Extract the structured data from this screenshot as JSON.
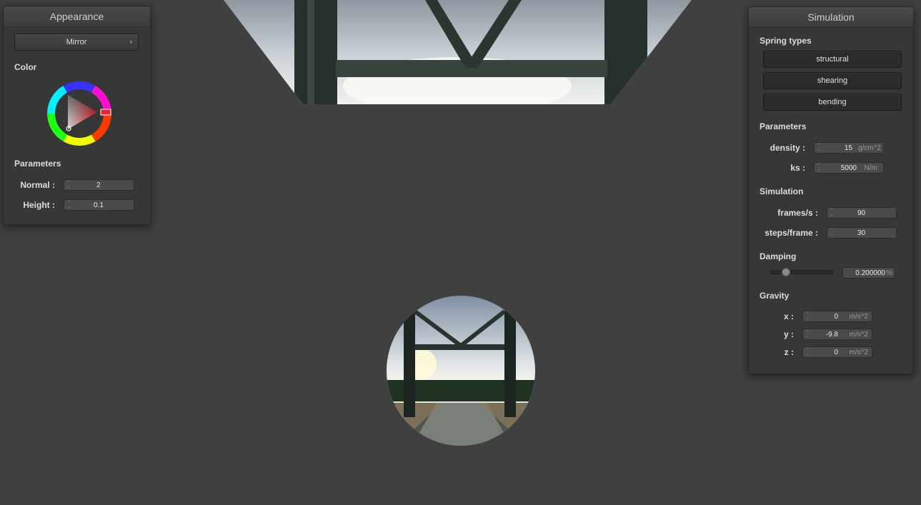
{
  "appearance": {
    "title": "Appearance",
    "material_dropdown": "Mirror",
    "color_label": "Color",
    "parameters_label": "Parameters",
    "normal": {
      "label": "Normal :",
      "value": "2"
    },
    "height": {
      "label": "Height :",
      "value": "0.1"
    }
  },
  "simulation": {
    "title": "Simulation",
    "spring_types_label": "Spring types",
    "spring_types": [
      "structural",
      "shearing",
      "bending"
    ],
    "parameters_label": "Parameters",
    "density": {
      "label": "density :",
      "value": "15",
      "unit": "g/cm^2"
    },
    "ks": {
      "label": "ks :",
      "value": "5000",
      "unit": "N/m"
    },
    "simulation_label": "Simulation",
    "fps": {
      "label": "frames/s :",
      "value": "90"
    },
    "steps": {
      "label": "steps/frame :",
      "value": "30"
    },
    "damping_label": "Damping",
    "damping": {
      "value": "0.200000",
      "unit": "%",
      "slider_fraction": 0.2
    },
    "gravity_label": "Gravity",
    "gravity": {
      "x": {
        "label": "x :",
        "value": "0",
        "unit": "m/s^2"
      },
      "y": {
        "label": "y :",
        "value": "-9.8",
        "unit": "m/s^2"
      },
      "z": {
        "label": "z :",
        "value": "0",
        "unit": "m/s^2"
      }
    }
  },
  "colors": {
    "background": "#404040",
    "panel": "#373737",
    "selected_color": "#e8262a"
  },
  "icons": {
    "dropdown_chevron": "chevron-right-icon",
    "spinner": "spinner-arrows-icon"
  }
}
